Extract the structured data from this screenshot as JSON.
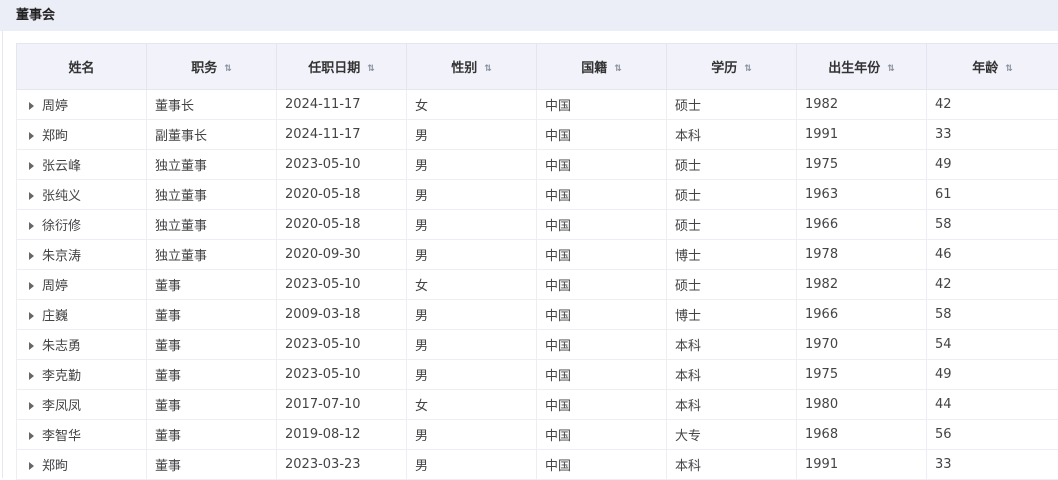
{
  "panel": {
    "title": "董事会"
  },
  "table": {
    "columns": [
      {
        "label": "姓名",
        "sortable": false
      },
      {
        "label": "职务",
        "sortable": true
      },
      {
        "label": "任职日期",
        "sortable": true
      },
      {
        "label": "性别",
        "sortable": true
      },
      {
        "label": "国籍",
        "sortable": true
      },
      {
        "label": "学历",
        "sortable": true
      },
      {
        "label": "出生年份",
        "sortable": true
      },
      {
        "label": "年龄",
        "sortable": true
      }
    ],
    "sort_icon": "⇅",
    "rows": [
      [
        "周婷",
        "董事长",
        "2024-11-17",
        "女",
        "中国",
        "硕士",
        "1982",
        "42"
      ],
      [
        "郑昫",
        "副董事长",
        "2024-11-17",
        "男",
        "中国",
        "本科",
        "1991",
        "33"
      ],
      [
        "张云峰",
        "独立董事",
        "2023-05-10",
        "男",
        "中国",
        "硕士",
        "1975",
        "49"
      ],
      [
        "张纯义",
        "独立董事",
        "2020-05-18",
        "男",
        "中国",
        "硕士",
        "1963",
        "61"
      ],
      [
        "徐衍修",
        "独立董事",
        "2020-05-18",
        "男",
        "中国",
        "硕士",
        "1966",
        "58"
      ],
      [
        "朱京涛",
        "独立董事",
        "2020-09-30",
        "男",
        "中国",
        "博士",
        "1978",
        "46"
      ],
      [
        "周婷",
        "董事",
        "2023-05-10",
        "女",
        "中国",
        "硕士",
        "1982",
        "42"
      ],
      [
        "庄巍",
        "董事",
        "2009-03-18",
        "男",
        "中国",
        "博士",
        "1966",
        "58"
      ],
      [
        "朱志勇",
        "董事",
        "2023-05-10",
        "男",
        "中国",
        "本科",
        "1970",
        "54"
      ],
      [
        "李克勤",
        "董事",
        "2023-05-10",
        "男",
        "中国",
        "本科",
        "1975",
        "49"
      ],
      [
        "李凤凤",
        "董事",
        "2017-07-10",
        "女",
        "中国",
        "本科",
        "1980",
        "44"
      ],
      [
        "李智华",
        "董事",
        "2019-08-12",
        "男",
        "中国",
        "大专",
        "1968",
        "56"
      ],
      [
        "郑昫",
        "董事",
        "2023-03-23",
        "男",
        "中国",
        "本科",
        "1991",
        "33"
      ]
    ]
  }
}
